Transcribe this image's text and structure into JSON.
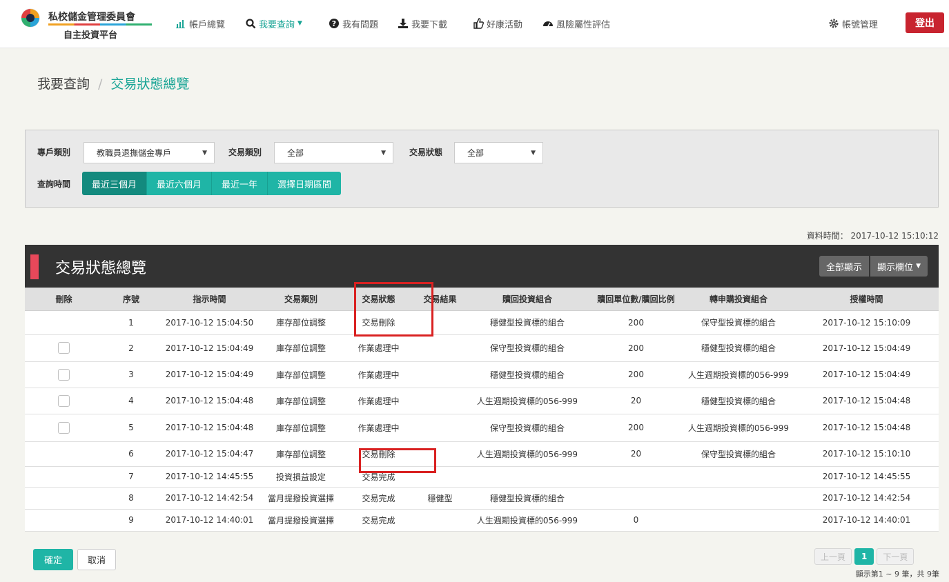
{
  "logo": {
    "line1": "私校儲金管理委員會",
    "line2": "自主投資平台"
  },
  "nav": [
    {
      "label": "帳戶總覽",
      "icon": "bar-chart-icon",
      "active": false
    },
    {
      "label": "我要查詢",
      "icon": "search-icon",
      "active": true,
      "dropdown": true
    },
    {
      "label": "我有問題",
      "icon": "question-icon",
      "active": false
    },
    {
      "label": "我要下載",
      "icon": "download-icon",
      "active": false
    },
    {
      "label": "好康活動",
      "icon": "thumbs-up-icon",
      "active": false
    },
    {
      "label": "風險屬性評估",
      "icon": "dashboard-icon",
      "active": false
    }
  ],
  "account": {
    "label": "帳號管理",
    "icon": "gear-icon",
    "logout": "登出"
  },
  "breadcrumb": {
    "parent": "我要查詢",
    "separator": "/",
    "current": "交易狀態總覽"
  },
  "filters": {
    "account_type": {
      "label": "專戶類別",
      "value": "教職員退撫儲金專戶"
    },
    "trade_type": {
      "label": "交易類別",
      "value": "全部"
    },
    "trade_status": {
      "label": "交易狀態",
      "value": "全部"
    },
    "period": {
      "label": "查詢時間",
      "options": [
        "最近三個月",
        "最近六個月",
        "最近一年",
        "選擇日期區間"
      ],
      "selected": "最近三個月"
    }
  },
  "data_time": "資料時間： 2017-10-12 15:10:12",
  "panel": {
    "title": "交易狀態總覽",
    "show_all": "全部顯示",
    "show_columns": "顯示欄位"
  },
  "table": {
    "columns": [
      "刪除",
      "序號",
      "指示時間",
      "交易類別",
      "交易狀態",
      "交易結果",
      "贖回投資組合",
      "贖回單位數/贖回比例",
      "轉申購投資組合",
      "授權時間"
    ],
    "rows": [
      {
        "checkbox": false,
        "cells": [
          "",
          "1",
          "2017-10-12 15:04:50",
          "庫存部位調整",
          "交易刪除",
          "",
          "穩健型投資標的組合",
          "200",
          "保守型投資標的組合",
          "2017-10-12 15:10:09"
        ]
      },
      {
        "checkbox": true,
        "cells": [
          "",
          "2",
          "2017-10-12 15:04:49",
          "庫存部位調整",
          "作業處理中",
          "",
          "保守型投資標的組合",
          "200",
          "穩健型投資標的組合",
          "2017-10-12 15:04:49"
        ]
      },
      {
        "checkbox": true,
        "cells": [
          "",
          "3",
          "2017-10-12 15:04:49",
          "庫存部位調整",
          "作業處理中",
          "",
          "穩健型投資標的組合",
          "200",
          "人生週期投資標的056-999",
          "2017-10-12 15:04:49"
        ]
      },
      {
        "checkbox": true,
        "cells": [
          "",
          "4",
          "2017-10-12 15:04:48",
          "庫存部位調整",
          "作業處理中",
          "",
          "人生週期投資標的056-999",
          "20",
          "穩健型投資標的組合",
          "2017-10-12 15:04:48"
        ]
      },
      {
        "checkbox": true,
        "cells": [
          "",
          "5",
          "2017-10-12 15:04:48",
          "庫存部位調整",
          "作業處理中",
          "",
          "保守型投資標的組合",
          "200",
          "人生週期投資標的056-999",
          "2017-10-12 15:04:48"
        ]
      },
      {
        "checkbox": false,
        "cells": [
          "",
          "6",
          "2017-10-12 15:04:47",
          "庫存部位調整",
          "交易刪除",
          "",
          "人生週期投資標的056-999",
          "20",
          "保守型投資標的組合",
          "2017-10-12 15:10:10"
        ]
      },
      {
        "checkbox": false,
        "cells": [
          "",
          "7",
          "2017-10-12 14:45:55",
          "投資損益設定",
          "交易完成",
          "",
          "",
          "",
          "",
          "2017-10-12 14:45:55"
        ]
      },
      {
        "checkbox": false,
        "cells": [
          "",
          "8",
          "2017-10-12 14:42:54",
          "當月提撥投資選擇",
          "交易完成",
          "穩健型",
          "穩健型投資標的組合",
          "",
          "",
          "2017-10-12 14:42:54"
        ]
      },
      {
        "checkbox": false,
        "cells": [
          "",
          "9",
          "2017-10-12 14:40:01",
          "當月提撥投資選擇",
          "交易完成",
          "",
          "人生週期投資標的056-999",
          "0",
          "",
          "2017-10-12 14:40:01"
        ]
      }
    ]
  },
  "footer": {
    "confirm": "確定",
    "cancel": "取消",
    "pager": {
      "prev": "上一頁",
      "current": "1",
      "next": "下一頁",
      "info": "顯示第1 ~ 9 筆，共 9筆"
    }
  },
  "colors": {
    "accent": "#1fb5a6",
    "logout": "#c8242f",
    "highlight": "#d92121",
    "header_dark": "#333333"
  }
}
